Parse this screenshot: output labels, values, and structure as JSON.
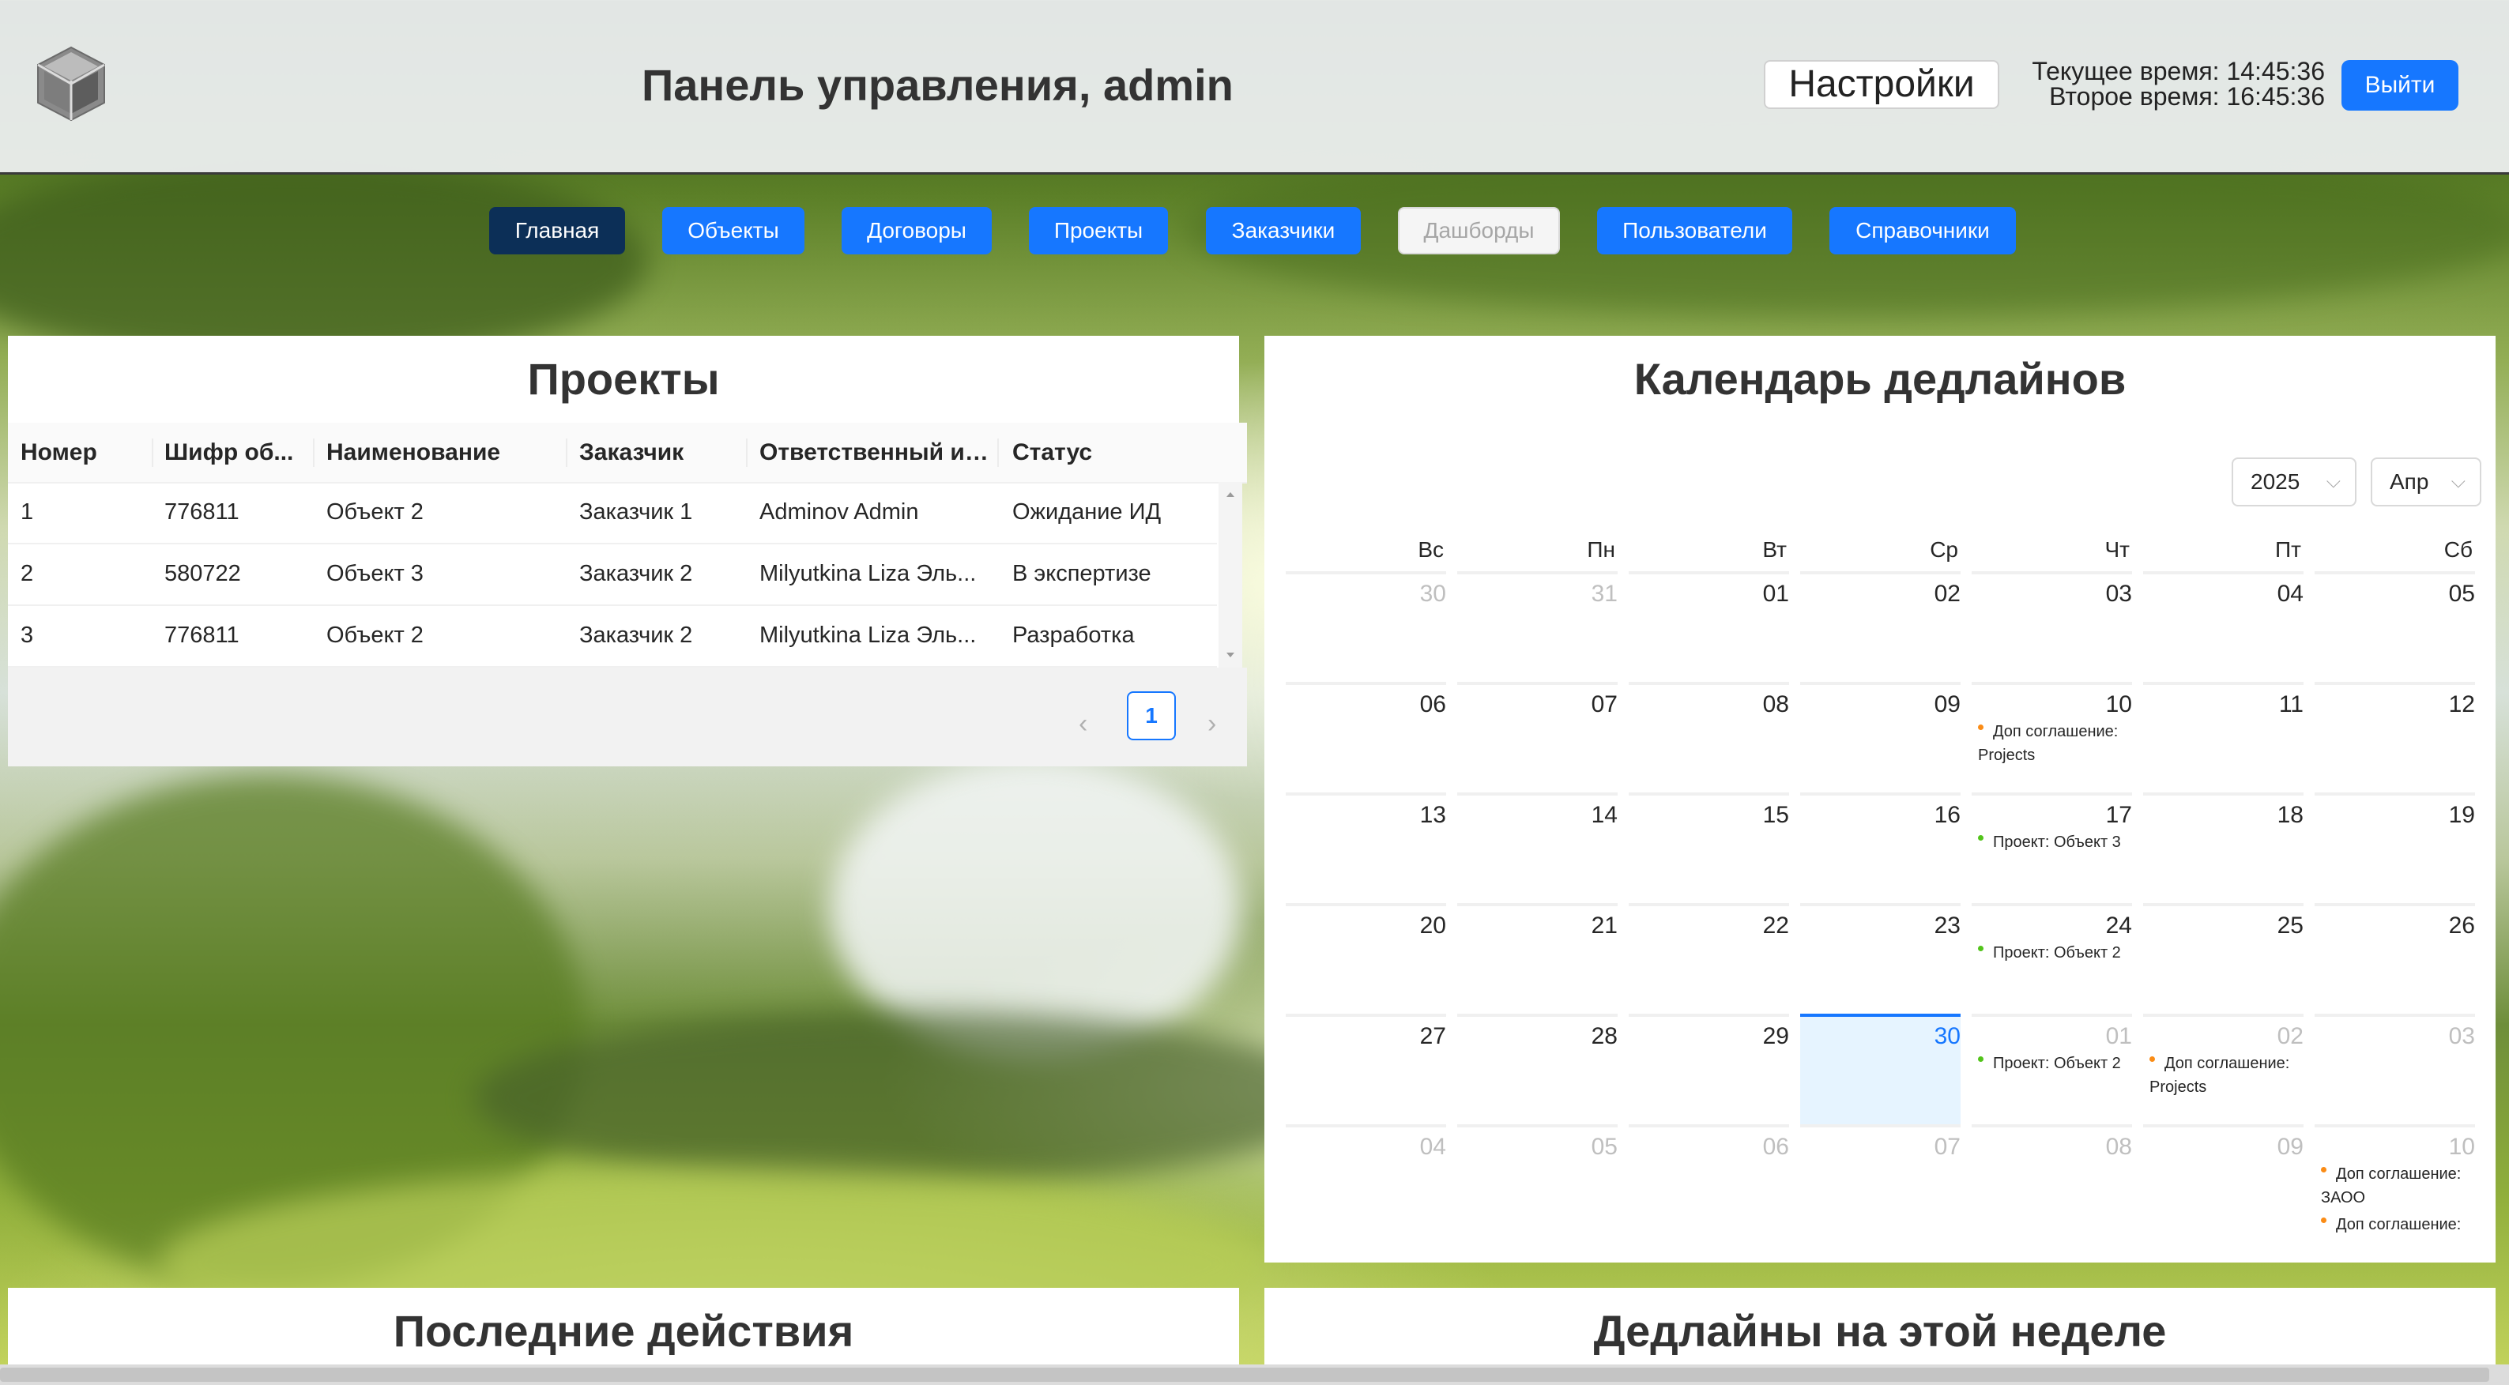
{
  "header": {
    "title": "Панель управления, admin",
    "settings_label": "Настройки",
    "current_time": "Текущее время: 14:45:36",
    "second_time": "Второе время: 16:45:36",
    "logout_label": "Выйти"
  },
  "nav": {
    "items": [
      "Главная",
      "Объекты",
      "Договоры",
      "Проекты",
      "Заказчики",
      "Дашборды",
      "Пользователи",
      "Справочники"
    ],
    "active": "Главная",
    "disabled": "Дашборды"
  },
  "projects": {
    "title": "Проекты",
    "columns": [
      "Номер",
      "Шифр об...",
      "Наименование",
      "Заказчик",
      "Ответственный ис...",
      "Статус"
    ],
    "rows": [
      [
        "1",
        "776811",
        "Объект 2",
        "Заказчик 1",
        "Adminov Admin",
        "Ожидание ИД"
      ],
      [
        "2",
        "580722",
        "Объект 3",
        "Заказчик 2",
        "Milyutkina Liza Эль...",
        "В экспертизе"
      ],
      [
        "3",
        "776811",
        "Объект 2",
        "Заказчик 2",
        "Milyutkina Liza Эль...",
        "Разработка"
      ]
    ],
    "current_page": "1"
  },
  "calendar": {
    "title": "Календарь дедлайнов",
    "year": "2025",
    "month": "Апр",
    "weekdays": [
      "Вс",
      "Пн",
      "Вт",
      "Ср",
      "Чт",
      "Пт",
      "Сб"
    ],
    "weeks": [
      [
        {
          "d": "30",
          "o": true
        },
        {
          "d": "31",
          "o": true
        },
        {
          "d": "01"
        },
        {
          "d": "02"
        },
        {
          "d": "03"
        },
        {
          "d": "04"
        },
        {
          "d": "05"
        }
      ],
      [
        {
          "d": "06"
        },
        {
          "d": "07"
        },
        {
          "d": "08"
        },
        {
          "d": "09"
        },
        {
          "d": "10",
          "events": [
            {
              "t": "Доп соглашение: Projects",
              "c": "orange"
            }
          ]
        },
        {
          "d": "11"
        },
        {
          "d": "12"
        }
      ],
      [
        {
          "d": "13"
        },
        {
          "d": "14"
        },
        {
          "d": "15"
        },
        {
          "d": "16"
        },
        {
          "d": "17",
          "events": [
            {
              "t": "Проект: Объект 3",
              "c": "green"
            }
          ]
        },
        {
          "d": "18"
        },
        {
          "d": "19"
        }
      ],
      [
        {
          "d": "20"
        },
        {
          "d": "21"
        },
        {
          "d": "22"
        },
        {
          "d": "23"
        },
        {
          "d": "24",
          "events": [
            {
              "t": "Проект: Объект 2",
              "c": "green"
            }
          ]
        },
        {
          "d": "25"
        },
        {
          "d": "26"
        }
      ],
      [
        {
          "d": "27"
        },
        {
          "d": "28"
        },
        {
          "d": "29"
        },
        {
          "d": "30",
          "today": true
        },
        {
          "d": "01",
          "o": true,
          "events": [
            {
              "t": "Проект: Объект 2",
              "c": "green"
            }
          ]
        },
        {
          "d": "02",
          "o": true,
          "events": [
            {
              "t": "Доп соглашение: Projects",
              "c": "orange"
            }
          ]
        },
        {
          "d": "03",
          "o": true
        }
      ],
      [
        {
          "d": "04",
          "o": true
        },
        {
          "d": "05",
          "o": true
        },
        {
          "d": "06",
          "o": true
        },
        {
          "d": "07",
          "o": true
        },
        {
          "d": "08",
          "o": true
        },
        {
          "d": "09",
          "o": true
        },
        {
          "d": "10",
          "o": true,
          "events": [
            {
              "t": "Доп соглашение: ЗАОО",
              "c": "orange"
            },
            {
              "t": "Доп соглашение:",
              "c": "orange"
            }
          ]
        }
      ]
    ]
  },
  "recent": {
    "title": "Последние действия"
  },
  "week_deadlines": {
    "title": "Дедлайны на этой неделе"
  }
}
